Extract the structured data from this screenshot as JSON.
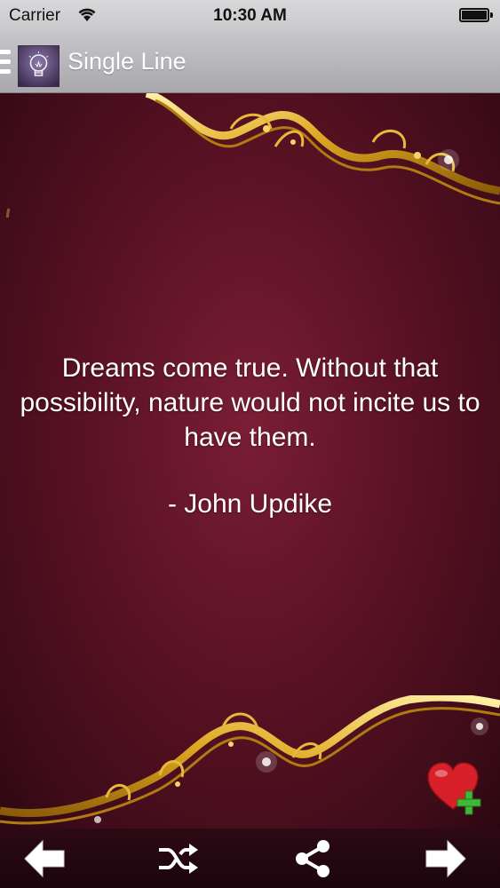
{
  "status": {
    "carrier": "Carrier",
    "time": "10:30 AM"
  },
  "nav": {
    "title": "Single Line",
    "menu_icon": "hamburger-menu-icon",
    "app_icon": "lightbulb-icon"
  },
  "quote": {
    "text": "Dreams come true. Without that possibility, nature would not incite us to have them.",
    "author": "- John Updike"
  },
  "actions": {
    "favorite_icon": "heart-plus-icon"
  },
  "toolbar": {
    "items": [
      {
        "icon": "arrow-left-icon"
      },
      {
        "icon": "shuffle-icon"
      },
      {
        "icon": "share-icon"
      },
      {
        "icon": "arrow-right-icon"
      }
    ]
  },
  "colors": {
    "background": "#5a1224",
    "ornament_gold": "#d9a520",
    "text": "#ffffff",
    "heart": "#d8202a",
    "plus": "#3fb83a"
  }
}
